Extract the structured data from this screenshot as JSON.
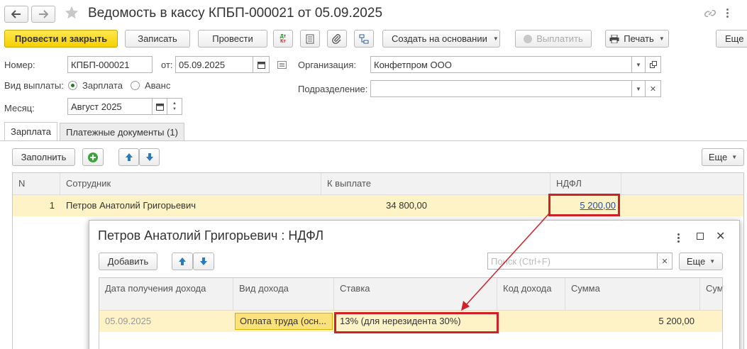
{
  "window": {
    "title": "Ведомость в кассу КПБП-000021 от 05.09.2025"
  },
  "toolbar": {
    "post_close": "Провести и закрыть",
    "save": "Записать",
    "post": "Провести",
    "dt_kt": "Дт Кт",
    "create_based": "Создать на основании",
    "pay": "Выплатить",
    "print": "Печать",
    "more": "Еще"
  },
  "form": {
    "number_label": "Номер:",
    "number_value": "КПБП-000021",
    "from_label": "от:",
    "date_value": "05.09.2025",
    "org_label": "Организация:",
    "org_value": "Конфетпром ООО",
    "pay_type_label": "Вид выплаты:",
    "pay_type_salary": "Зарплата",
    "pay_type_advance": "Аванс",
    "dept_label": "Подразделение:",
    "dept_value": "",
    "month_label": "Месяц:",
    "month_value": "Август 2025"
  },
  "tabs": [
    {
      "label": "Зарплата"
    },
    {
      "label": "Платежные документы (1)"
    }
  ],
  "table_toolbar": {
    "fill": "Заполнить",
    "more": "Еще"
  },
  "table": {
    "headers": [
      "N",
      "Сотрудник",
      "К выплате",
      "НДФЛ"
    ],
    "rows": [
      {
        "n": "1",
        "employee": "Петров Анатолий Григорьевич",
        "payout": "34 800,00",
        "ndfl": "5 200,00"
      }
    ]
  },
  "dialog": {
    "title": "Петров Анатолий Григорьевич : НДФЛ",
    "add": "Добавить",
    "search_placeholder": "Поиск (Ctrl+F)",
    "more": "Еще",
    "headers": [
      "Дата получения дохода",
      "Вид дохода",
      "Ставка",
      "Код дохода",
      "Сумма",
      "Сум"
    ],
    "rows": [
      {
        "date": "05.09.2025",
        "income_type": "Оплата труда (осн...",
        "rate": "13% (для нерезидента 30%)",
        "code": "",
        "sum": "5 200,00"
      }
    ]
  },
  "colors": {
    "accent_yellow": "#f5d000",
    "highlight_red": "#d0202a",
    "row_highlight": "#fdf3c6",
    "link_blue": "#2050b0"
  }
}
